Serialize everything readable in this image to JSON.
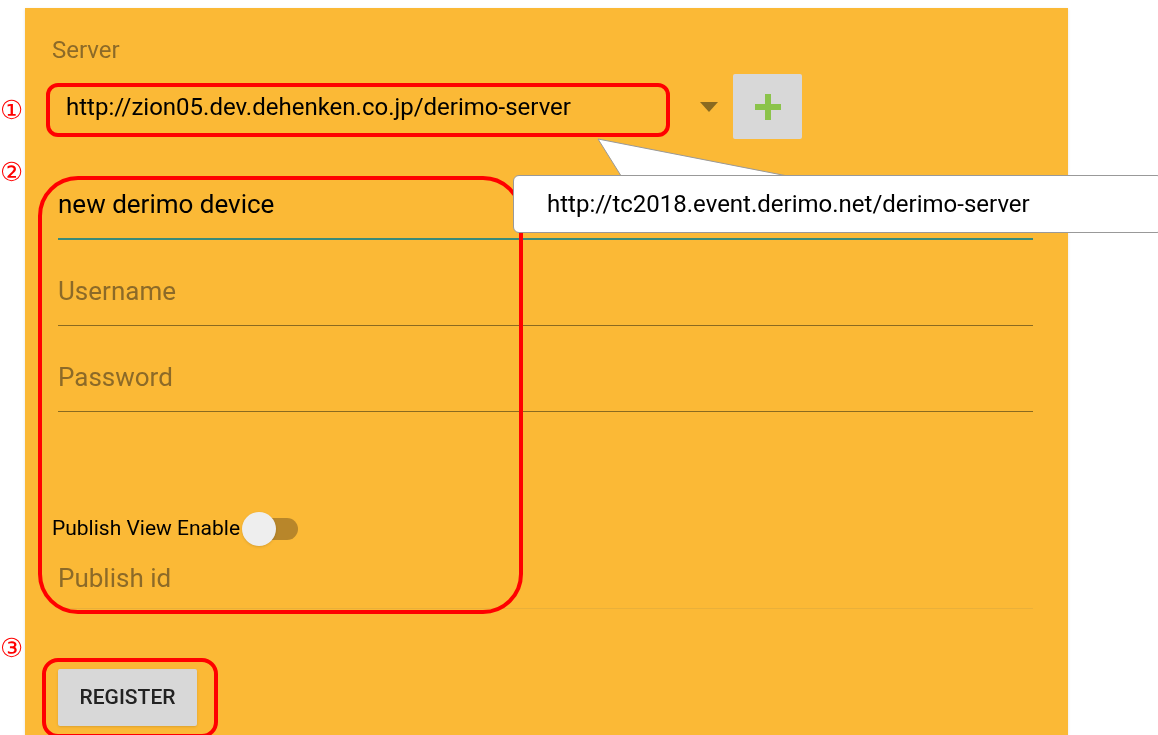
{
  "server": {
    "label": "Server",
    "value": "http://zion05.dev.dehenken.co.jp/derimo-server"
  },
  "fields": [
    {
      "kind": "filled",
      "value": "new derimo device",
      "focused": true
    },
    {
      "kind": "empty",
      "placeholder": "Username",
      "focused": false
    },
    {
      "kind": "empty",
      "placeholder": "Password",
      "focused": false
    }
  ],
  "publish_toggle": {
    "label": "Publish View Enable",
    "on": false
  },
  "publish_id": {
    "placeholder": "Publish id"
  },
  "register_button": "REGISTER",
  "callout": {
    "text": "http://tc2018.event.derimo.net/derimo-server"
  },
  "markers": [
    "①",
    "②",
    "③"
  ]
}
